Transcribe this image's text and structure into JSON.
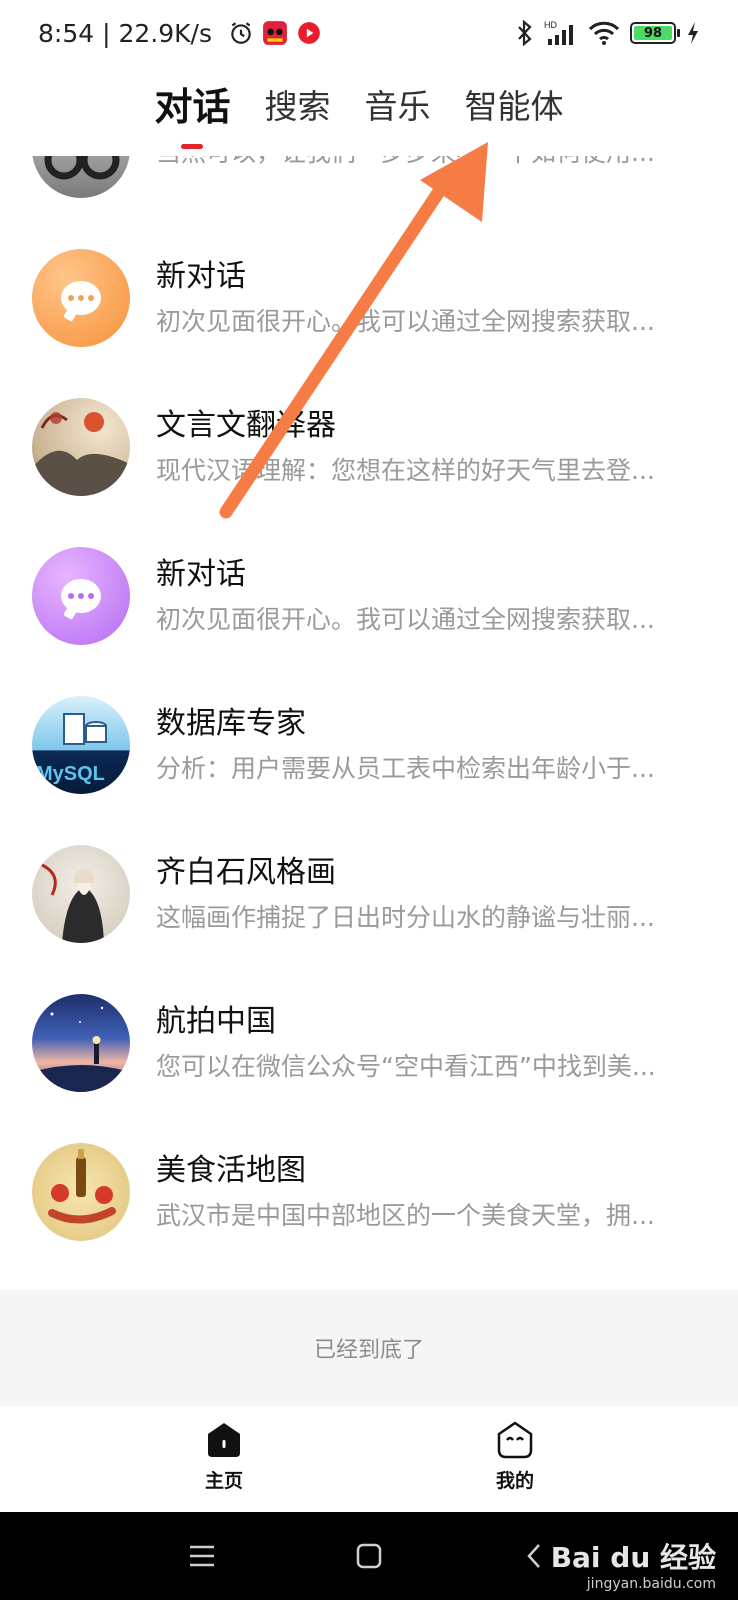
{
  "status_bar": {
    "time_speed": "8:54 | 22.9K/s",
    "battery_level": "98"
  },
  "tabs": [
    {
      "label": "对话",
      "active": true
    },
    {
      "label": "搜索",
      "active": false
    },
    {
      "label": "音乐",
      "active": false
    },
    {
      "label": "智能体",
      "active": false
    }
  ],
  "conversations": [
    {
      "title": "",
      "subtitle": "当然可以，让我们一步步来看一下如何使用...",
      "avatar": "glasses"
    },
    {
      "title": "新对话",
      "subtitle": "初次见面很开心。我可以通过全网搜索获取...",
      "avatar": "chat-orange"
    },
    {
      "title": "文言文翻译器",
      "subtitle": "现代汉语理解：您想在这样的好天气里去登...",
      "avatar": "ink-landscape"
    },
    {
      "title": "新对话",
      "subtitle": "初次见面很开心。我可以通过全网搜索获取...",
      "avatar": "chat-purple"
    },
    {
      "title": "数据库专家",
      "subtitle": "分析：用户需要从员工表中检索出年龄小于...",
      "avatar": "mysql"
    },
    {
      "title": "齐白石风格画",
      "subtitle": "这幅画作捕捉了日出时分山水的静谧与壮丽...",
      "avatar": "qi-baishi"
    },
    {
      "title": "航拍中国",
      "subtitle": "您可以在微信公众号“空中看江西”中找到美...",
      "avatar": "sky"
    },
    {
      "title": "美食活地图",
      "subtitle": "武汉市是中国中部地区的一个美食天堂，拥...",
      "avatar": "food"
    }
  ],
  "end_of_list": "已经到底了",
  "bottom_nav": {
    "home_label": "主页",
    "me_label": "我的"
  },
  "watermark": {
    "main": "Bai du 经验",
    "sub": "jingyan.baidu.com"
  },
  "colors": {
    "accent_red": "#e3242b",
    "annotation_arrow": "#f57c44"
  }
}
